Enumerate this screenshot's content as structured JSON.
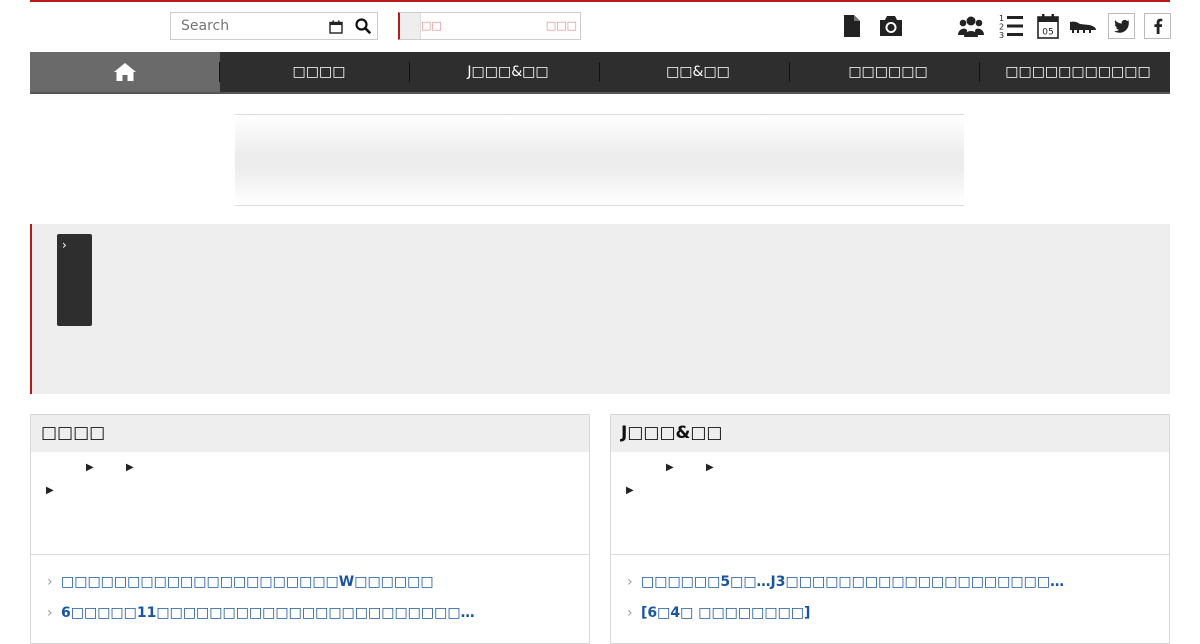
{
  "search": {
    "placeholder": "Search"
  },
  "login": {
    "left_label": "□□",
    "right_label": "□□□"
  },
  "header_icons": [
    "document-icon",
    "camera-icon",
    "group-icon",
    "ranking-list-icon",
    "calendar-icon",
    "cleats-icon",
    "twitter-icon",
    "facebook-icon"
  ],
  "nav": {
    "items": [
      "□□□□",
      "J□□□&□□",
      "□□&□□",
      "□□□□□□",
      "□□□□□□□□□□□"
    ]
  },
  "ticker": {
    "arrow": "›"
  },
  "panels": [
    {
      "title": "□□□□",
      "links": [
        "□□□□□□□□□□□□□□□□□□□□□W□□□□□□",
        "6□□□□□11□□□□□□□□□□□□□□□□□□□□□□□…"
      ]
    },
    {
      "title": "J□□□&□□",
      "links": [
        "□□□□□□5□□…J3□□□□□□□□□□□□□□□□□□□□…",
        "[6□4□ □□□□□□□□]"
      ]
    }
  ],
  "colors": {
    "accent": "#b71c1c",
    "nav_bg": "#2e2e2e",
    "nav_home_bg": "#6a6a6a",
    "link": "#1a56a0"
  }
}
